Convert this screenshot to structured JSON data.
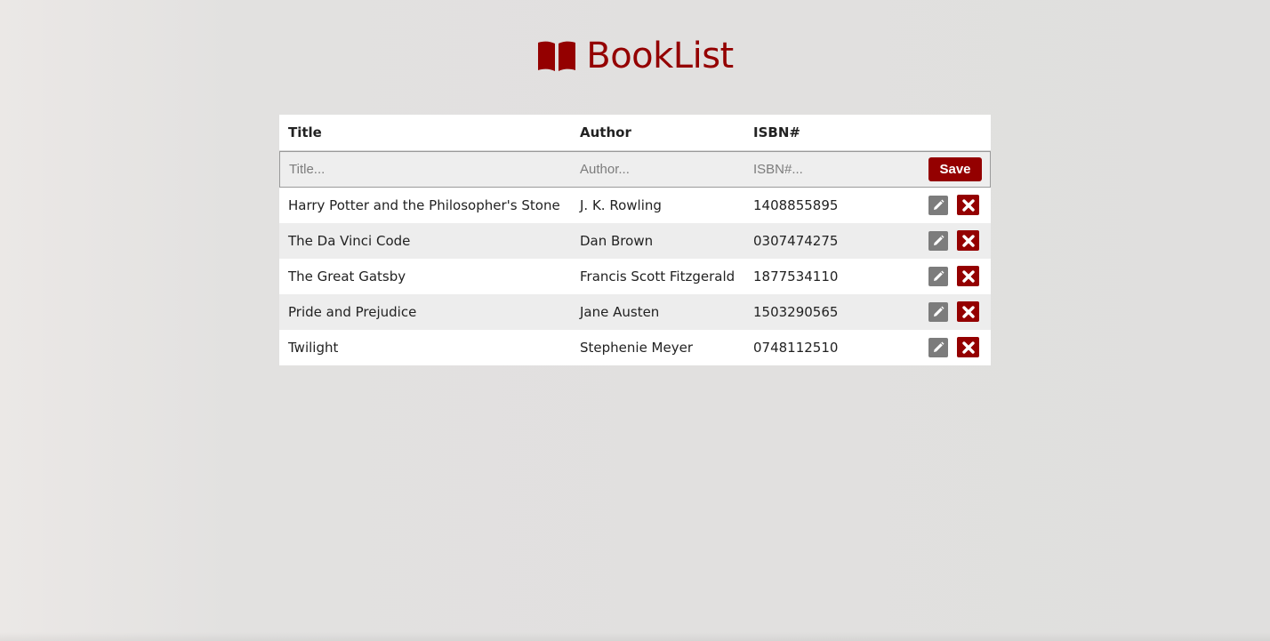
{
  "app": {
    "title": "BookList",
    "logo_icon": "open-book-icon",
    "accent_color": "#940000"
  },
  "table": {
    "headers": {
      "title": "Title",
      "author": "Author",
      "isbn": "ISBN#"
    },
    "form": {
      "title_placeholder": "Title...",
      "author_placeholder": "Author...",
      "isbn_placeholder": "ISBN#...",
      "title_value": "",
      "author_value": "",
      "isbn_value": "",
      "save_label": "Save"
    },
    "rows": [
      {
        "title": "Harry Potter and the Philosopher's Stone",
        "author": "J. K. Rowling",
        "isbn": "1408855895"
      },
      {
        "title": "The Da Vinci Code",
        "author": "Dan Brown",
        "isbn": "0307474275"
      },
      {
        "title": "The Great Gatsby",
        "author": "Francis Scott Fitzgerald",
        "isbn": "1877534110"
      },
      {
        "title": "Pride and Prejudice",
        "author": "Jane Austen",
        "isbn": "1503290565"
      },
      {
        "title": "Twilight",
        "author": "Stephenie Meyer",
        "isbn": "0748112510"
      }
    ],
    "row_icons": {
      "edit": "pencil-icon",
      "delete": "close-icon"
    }
  }
}
